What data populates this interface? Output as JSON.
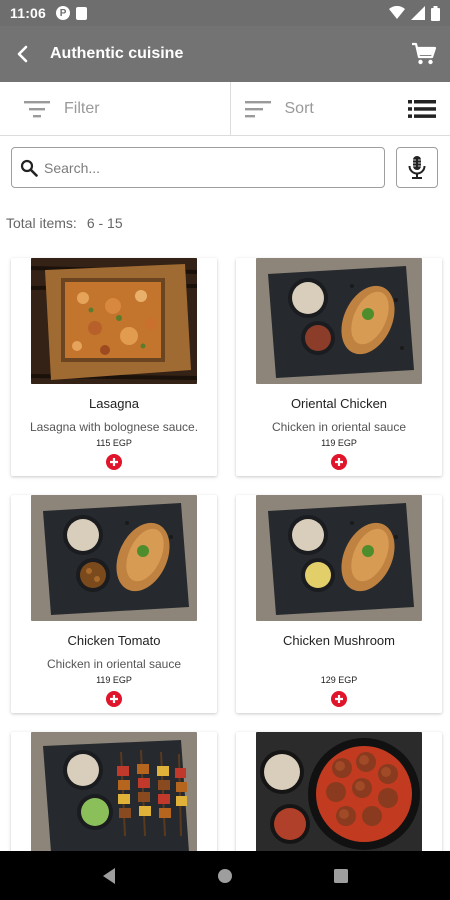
{
  "status_bar": {
    "time": "11:06",
    "notif_letter": "P"
  },
  "app_bar": {
    "title": "Authentic cuisine"
  },
  "toolbar": {
    "filter_label": "Filter",
    "sort_label": "Sort"
  },
  "search": {
    "placeholder": "Search..."
  },
  "summary": {
    "label": "Total items:",
    "value": "6 - 15"
  },
  "products": [
    {
      "name": "Lasagna",
      "description": "Lasagna with bolognese sauce.",
      "price": "115 EGP",
      "image": "lasagna-tray"
    },
    {
      "name": "Oriental Chicken",
      "description": "Chicken in oriental sauce",
      "price": "119 EGP",
      "image": "chicken-rice-plate"
    },
    {
      "name": "Chicken Tomato",
      "description": "Chicken in oriental sauce",
      "price": "119 EGP",
      "image": "chicken-tomato-plate"
    },
    {
      "name": "Chicken Mushroom",
      "description": "",
      "price": "129 EGP",
      "image": "chicken-mushroom-plate"
    },
    {
      "name": "",
      "description": "",
      "price": "",
      "image": "kebab-skewers-plate"
    },
    {
      "name": "",
      "description": "",
      "price": "",
      "image": "meatballs-pan"
    }
  ],
  "icons": {
    "back": "arrow-back-icon",
    "cart": "cart-icon",
    "filter": "filter-icon",
    "sort": "sort-icon",
    "view": "list-view-icon",
    "search": "search-icon",
    "mic": "mic-icon",
    "add": "add-icon"
  },
  "colors": {
    "app_bar": "#737373",
    "status_bar": "#6e6e6e",
    "add_button": "#e0142a"
  }
}
